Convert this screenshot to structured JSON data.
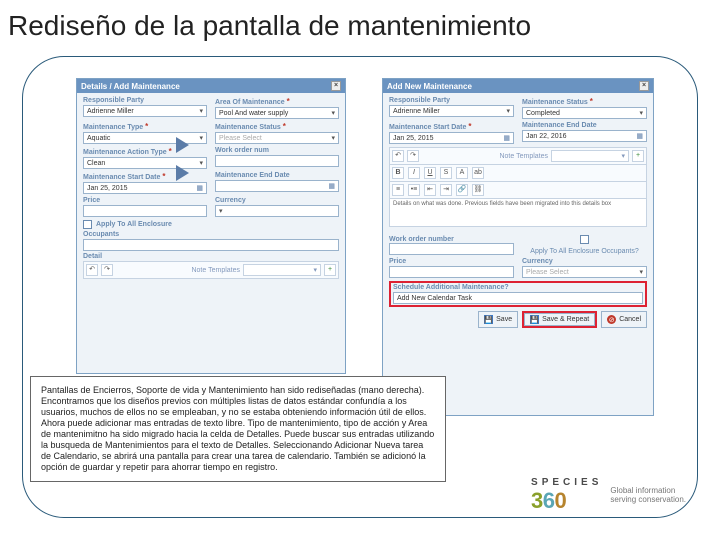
{
  "slide": {
    "title": "Rediseño de la pantalla de mantenimiento"
  },
  "left": {
    "header": "Details / Add Maintenance",
    "responsible_party_lbl": "Responsible Party",
    "responsible_party_val": "Adrienne Miller",
    "area_lbl": "Area Of Maintenance",
    "area_val": "Pool And water supply",
    "mtype_lbl": "Maintenance Type",
    "mtype_val": "Aquatic",
    "mstatus_lbl": "Maintenance Status",
    "mstatus_val": "Please Select",
    "maction_lbl": "Maintenance Action Type",
    "maction_val": "Clean",
    "workorder_lbl": "Work order num",
    "startdate_lbl": "Maintenance Start Date",
    "startdate_val": "Jan 25, 2015",
    "enddate_lbl": "Maintenance End Date",
    "price_lbl": "Price",
    "currency_lbl": "Currency",
    "apply_lbl": "Apply To All Enclosure",
    "occupants_lbl": "Occupants",
    "detail_lbl": "Detail",
    "note_templates": "Note Templates"
  },
  "right": {
    "header": "Add New Maintenance",
    "responsible_party_lbl": "Responsible Party",
    "responsible_party_val": "Adrienne Miller",
    "mstatus_lbl": "Maintenance Status",
    "mstatus_val": "Completed",
    "startdate_lbl": "Maintenance Start Date",
    "startdate_val": "Jan 25, 2015",
    "enddate_lbl": "Maintenance End Date",
    "enddate_val": "Jan 22, 2016",
    "note_templates": "Note Templates",
    "rte_placeholder": "Details on what was done. Previous fields have been migrated into this details box",
    "workorder_lbl": "Work order number",
    "apply_lbl": "Apply To All Enclosure Occupants?",
    "price_lbl": "Price",
    "currency_lbl": "Currency",
    "currency_val": "Please Select",
    "schedule_lbl": "Schedule Additional Maintenance?",
    "addcal_lbl": "Add New Calendar Task",
    "save_label": "Save",
    "save_repeat_label": "Save & Repeat",
    "cancel_label": "Cancel"
  },
  "summary": {
    "text": "Pantallas de Encierros, Soporte de vida y Mantenimiento han sido rediseñadas (mano derecha). Encontramos que los diseños previos con múltiples listas de datos estándar confundía a los usuarios, muchos de ellos no se empleaban, y no se estaba obteniendo información útil de ellos. Ahora puede adicionar mas entradas de texto libre. Tipo de mantenimiento, tipo de acción y Area de mantenimitno ha sido migrado hacia la celda de Detalles. Puede buscar sus entradas utilizando la busqueda de Mantenimientos para el texto de Detalles. Seleccionando Adicionar Nueva tarea de Calendario, se abrirá una pantalla para crear una tarea de calendario. También se adicionó la opción de guardar y repetir para ahorrar tiempo en registro."
  },
  "brand": {
    "name": "SPECIES",
    "digits": {
      "a": "3",
      "b": "6",
      "c": "0"
    },
    "tag1": "Global information",
    "tag2": "serving conservation."
  }
}
